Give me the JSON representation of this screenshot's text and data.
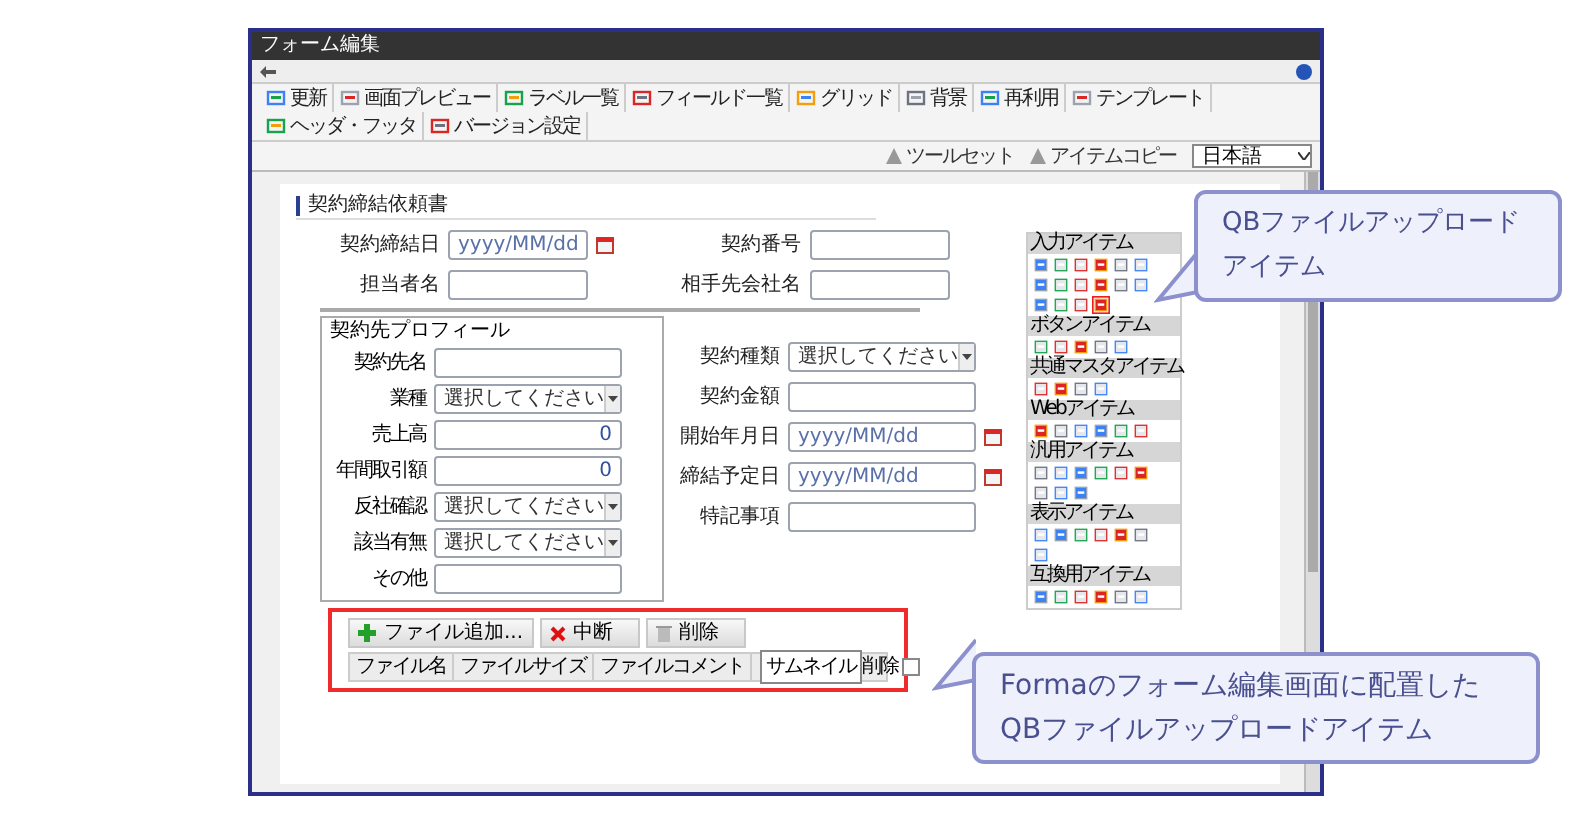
{
  "window": {
    "title": "フォーム編集"
  },
  "toolbar": [
    {
      "label": "更新"
    },
    {
      "label": "画面プレビュー"
    },
    {
      "label": "ラベル一覧"
    },
    {
      "label": "フィールド一覧"
    },
    {
      "label": "グリッド"
    },
    {
      "label": "背景"
    },
    {
      "label": "再利用"
    },
    {
      "label": "テンプレート"
    },
    {
      "label": "ヘッダ・フッタ"
    },
    {
      "label": "バージョン設定"
    }
  ],
  "tools": [
    {
      "label": "ツールセット"
    },
    {
      "label": "アイテムコピー"
    }
  ],
  "language": {
    "value": "日本語"
  },
  "form": {
    "section_title": "契約締結依頼書",
    "top_fields": [
      {
        "label": "契約締結日",
        "kind": "date",
        "placeholder": "yyyy/MM/dd"
      },
      {
        "label": "契約番号",
        "kind": "text"
      },
      {
        "label": "担当者名",
        "kind": "text"
      },
      {
        "label": "相手先会社名",
        "kind": "text"
      }
    ],
    "profile": {
      "title": "契約先プロフィール",
      "fields": [
        {
          "label": "契約先名",
          "kind": "text"
        },
        {
          "label": "業種",
          "kind": "select",
          "value": "選択してください"
        },
        {
          "label": "売上高",
          "kind": "number",
          "value": "0"
        },
        {
          "label": "年間取引額",
          "kind": "number",
          "value": "0"
        },
        {
          "label": "反社確認",
          "kind": "select",
          "value": "選択してください"
        },
        {
          "label": "該当有無",
          "kind": "select",
          "value": "選択してください"
        },
        {
          "label": "その他",
          "kind": "text"
        }
      ]
    },
    "right_fields": [
      {
        "label": "契約種類",
        "kind": "select",
        "value": "選択してください"
      },
      {
        "label": "契約金額",
        "kind": "text"
      },
      {
        "label": "開始年月日",
        "kind": "date",
        "placeholder": "yyyy/MM/dd"
      },
      {
        "label": "締結予定日",
        "kind": "date",
        "placeholder": "yyyy/MM/dd"
      },
      {
        "label": "特記事項",
        "kind": "text"
      }
    ]
  },
  "palette": [
    {
      "title": "入力アイテム",
      "icons": [
        {
          "selected": false
        },
        {
          "selected": false
        },
        {
          "selected": false
        },
        {
          "selected": false
        },
        {
          "selected": false
        },
        {
          "selected": false
        },
        {
          "selected": false
        },
        {
          "selected": false
        },
        {
          "selected": false
        },
        {
          "selected": false
        },
        {
          "selected": false
        },
        {
          "selected": false
        },
        {
          "selected": false
        },
        {
          "selected": false
        },
        {
          "selected": false
        },
        {
          "selected": true
        }
      ]
    },
    {
      "title": "ボタンアイテム",
      "icons": [
        {
          "selected": false
        },
        {
          "selected": false
        },
        {
          "selected": false
        },
        {
          "selected": false
        },
        {
          "selected": false
        }
      ]
    },
    {
      "title": "共通マスタアイテム",
      "icons": [
        {
          "selected": false
        },
        {
          "selected": false
        },
        {
          "selected": false
        },
        {
          "selected": false
        }
      ]
    },
    {
      "title": "Webアイテム",
      "icons": [
        {
          "selected": false
        },
        {
          "selected": false
        },
        {
          "selected": false
        },
        {
          "selected": false
        },
        {
          "selected": false
        },
        {
          "selected": false
        }
      ]
    },
    {
      "title": "汎用アイテム",
      "icons": [
        {
          "selected": false
        },
        {
          "selected": false
        },
        {
          "selected": false
        },
        {
          "selected": false
        },
        {
          "selected": false
        },
        {
          "selected": false
        },
        {
          "selected": false
        },
        {
          "selected": false
        },
        {
          "selected": false
        }
      ]
    },
    {
      "title": "表示アイテム",
      "icons": [
        {
          "selected": false
        },
        {
          "selected": false
        },
        {
          "selected": false
        },
        {
          "selected": false
        },
        {
          "selected": false
        },
        {
          "selected": false
        },
        {
          "selected": false
        }
      ]
    },
    {
      "title": "互換用アイテム",
      "icons": [
        {
          "selected": false
        },
        {
          "selected": false
        },
        {
          "selected": false
        },
        {
          "selected": false
        },
        {
          "selected": false
        },
        {
          "selected": false
        }
      ]
    }
  ],
  "upload": {
    "buttons": [
      {
        "label": "ファイル追加...",
        "kind": "add"
      },
      {
        "label": "中断",
        "kind": "cancel"
      },
      {
        "label": "削除",
        "kind": "delete"
      }
    ],
    "columns": [
      "ファイル名",
      "ファイルサイズ",
      "ファイルコメント"
    ],
    "view_select": "サムネイル",
    "delete_label": "削除",
    "delete_checked": false
  },
  "callouts": [
    {
      "text": "QBファイルアップロードアイテム"
    },
    {
      "text": "Formaのフォーム編集画面に配置したQBファイルアップロードアイテム"
    }
  ]
}
